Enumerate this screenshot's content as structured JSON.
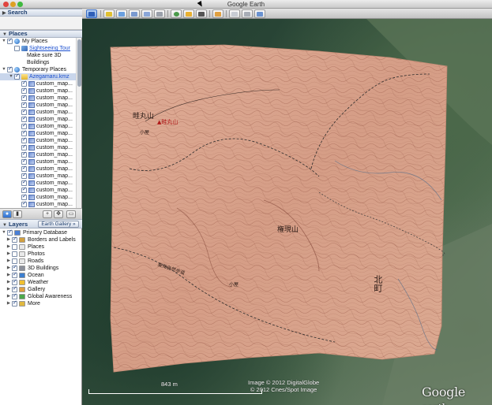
{
  "window": {
    "title": "Google Earth"
  },
  "sidebar": {
    "search_label": "Search",
    "places_label": "Places",
    "places_tree": [
      {
        "label": "My Places",
        "indent": 0,
        "expanded": true,
        "checked": true,
        "icon": "globe-icon",
        "link": false,
        "selected": false
      },
      {
        "label": "Sightseeing Tour",
        "indent": 1,
        "checked": false,
        "icon": "tour-icon",
        "link": true,
        "selected": false
      },
      {
        "label": "Make sure 3D",
        "indent": 1,
        "checked": null,
        "icon": "",
        "link": false,
        "selected": false,
        "plain": true
      },
      {
        "label": "Buildings",
        "indent": 1,
        "checked": null,
        "icon": "",
        "link": false,
        "selected": false,
        "plain": true
      },
      {
        "label": "Temporary Places",
        "indent": 0,
        "expanded": true,
        "checked": true,
        "icon": "globe-icon",
        "link": false,
        "selected": false
      },
      {
        "label": "Azegamaru.kmz",
        "indent": 1,
        "expanded": true,
        "checked": true,
        "icon": "folder-icon",
        "link": false,
        "selected": true
      },
      {
        "label": "custom_map...",
        "indent": 2,
        "checked": true,
        "icon": "map-overlay-icon",
        "link": false,
        "selected": false
      },
      {
        "label": "custom_map...",
        "indent": 2,
        "checked": true,
        "icon": "map-overlay-icon",
        "link": false,
        "selected": false
      },
      {
        "label": "custom_map...",
        "indent": 2,
        "checked": true,
        "icon": "map-overlay-icon",
        "link": false,
        "selected": false
      },
      {
        "label": "custom_map...",
        "indent": 2,
        "checked": true,
        "icon": "map-overlay-icon",
        "link": false,
        "selected": false
      },
      {
        "label": "custom_map...",
        "indent": 2,
        "checked": true,
        "icon": "map-overlay-icon",
        "link": false,
        "selected": false
      },
      {
        "label": "custom_map...",
        "indent": 2,
        "checked": true,
        "icon": "map-overlay-icon",
        "link": false,
        "selected": false
      },
      {
        "label": "custom_map...",
        "indent": 2,
        "checked": true,
        "icon": "map-overlay-icon",
        "link": false,
        "selected": false
      },
      {
        "label": "custom_map...",
        "indent": 2,
        "checked": true,
        "icon": "map-overlay-icon",
        "link": false,
        "selected": false
      },
      {
        "label": "custom_map...",
        "indent": 2,
        "checked": true,
        "icon": "map-overlay-icon",
        "link": false,
        "selected": false
      },
      {
        "label": "custom_map...",
        "indent": 2,
        "checked": true,
        "icon": "map-overlay-icon",
        "link": false,
        "selected": false
      },
      {
        "label": "custom_map...",
        "indent": 2,
        "checked": true,
        "icon": "map-overlay-icon",
        "link": false,
        "selected": false
      },
      {
        "label": "custom_map...",
        "indent": 2,
        "checked": true,
        "icon": "map-overlay-icon",
        "link": false,
        "selected": false
      },
      {
        "label": "custom_map...",
        "indent": 2,
        "checked": true,
        "icon": "map-overlay-icon",
        "link": false,
        "selected": false
      },
      {
        "label": "custom_map...",
        "indent": 2,
        "checked": true,
        "icon": "map-overlay-icon",
        "link": false,
        "selected": false
      },
      {
        "label": "custom_map...",
        "indent": 2,
        "checked": true,
        "icon": "map-overlay-icon",
        "link": false,
        "selected": false
      },
      {
        "label": "custom_map...",
        "indent": 2,
        "checked": true,
        "icon": "map-overlay-icon",
        "link": false,
        "selected": false
      },
      {
        "label": "custom_map...",
        "indent": 2,
        "checked": true,
        "icon": "map-overlay-icon",
        "link": false,
        "selected": false
      },
      {
        "label": "custom_map...",
        "indent": 2,
        "checked": true,
        "icon": "map-overlay-icon",
        "link": false,
        "selected": false
      }
    ],
    "layers_label": "Layers",
    "earth_gallery_label": "Earth Gallery »",
    "layers_tree": [
      {
        "label": "Primary Database",
        "indent": 0,
        "expanded": true,
        "checked": true,
        "icon": "database-icon",
        "color": "#4a7fd6"
      },
      {
        "label": "Borders and Labels",
        "indent": 1,
        "expanded": false,
        "checked": true,
        "icon": "borders-icon",
        "color": "#d2a040"
      },
      {
        "label": "Places",
        "indent": 1,
        "expanded": false,
        "checked": false,
        "icon": "places-icon",
        "color": "#e9e9e9"
      },
      {
        "label": "Photos",
        "indent": 1,
        "expanded": false,
        "checked": false,
        "icon": "photos-icon",
        "color": "#e9e9e9"
      },
      {
        "label": "Roads",
        "indent": 1,
        "expanded": false,
        "checked": false,
        "icon": "roads-icon",
        "color": "#e9e9e9"
      },
      {
        "label": "3D Buildings",
        "indent": 1,
        "expanded": false,
        "checked": true,
        "icon": "buildings-icon",
        "color": "#8b8f9a"
      },
      {
        "label": "Ocean",
        "indent": 1,
        "expanded": false,
        "checked": true,
        "icon": "ocean-icon",
        "color": "#3d7fd0"
      },
      {
        "label": "Weather",
        "indent": 1,
        "expanded": false,
        "checked": true,
        "icon": "weather-icon",
        "color": "#f0c030"
      },
      {
        "label": "Gallery",
        "indent": 1,
        "expanded": false,
        "checked": true,
        "icon": "gallery-icon",
        "color": "#e0a040"
      },
      {
        "label": "Global Awareness",
        "indent": 1,
        "expanded": false,
        "checked": true,
        "icon": "global-awareness-icon",
        "color": "#4ca84c"
      },
      {
        "label": "More",
        "indent": 1,
        "expanded": false,
        "checked": true,
        "icon": "more-icon",
        "color": "#e0b840"
      }
    ]
  },
  "map": {
    "attribution_line1": "Image © 2012 DigitalGlobe",
    "attribution_line2": "© 2012 Cnes/Spot Image",
    "scale_label": "843 m",
    "logo_word1": "Google",
    "logo_word2": "earth",
    "labels": {
      "mountain1": "畦丸山",
      "mountain1_sub": "▲畦丸山",
      "mountain2": "権現山",
      "town": "北町",
      "trail": "東海自然歩道",
      "small1": "小屋",
      "small2": "小屋"
    }
  },
  "colors": {
    "overlay_pink": "#d9a48e",
    "contour": "#8a4a3a",
    "selection": "#c9d6ec",
    "link": "#1a4fd0"
  }
}
